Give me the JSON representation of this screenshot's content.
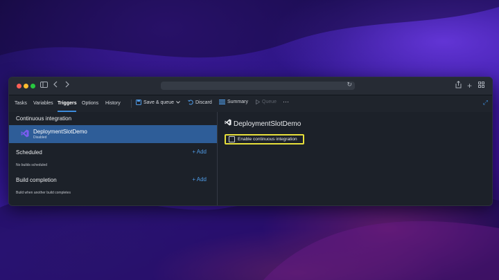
{
  "window": {
    "address": "",
    "tabs": [
      {
        "label": "Tasks"
      },
      {
        "label": "Variables"
      },
      {
        "label": "Triggers"
      },
      {
        "label": "Options"
      },
      {
        "label": "History"
      }
    ],
    "active_tab": "Triggers",
    "tools": {
      "save_queue": "Save & queue",
      "discard": "Discard",
      "summary": "Summary",
      "queue": "Queue",
      "more": "···"
    }
  },
  "left": {
    "ci_title": "Continuous integration",
    "pipeline": {
      "name": "DeploymentSlotDemo",
      "status": "Disabled"
    },
    "scheduled": {
      "title": "Scheduled",
      "add": "Add",
      "empty": "No builds scheduled"
    },
    "build_completion": {
      "title": "Build completion",
      "add": "Add",
      "empty": "Build when another build completes"
    }
  },
  "right": {
    "title": "DeploymentSlotDemo",
    "checkbox_label": "Enable continuous integration",
    "checkbox_checked": false
  },
  "colors": {
    "accent": "#3d8bdb",
    "selection": "#2e5d98",
    "highlight": "#e8e03a",
    "vs_purple": "#7b5cf0"
  }
}
